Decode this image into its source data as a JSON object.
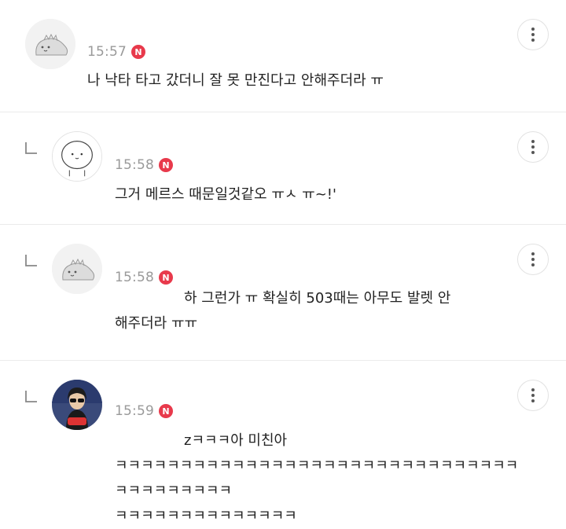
{
  "comments": [
    {
      "time": "15:57",
      "badge": "N",
      "text": "나 낙타 타고 갔더니 잘 못 만진다고 안해주더라 ㅠ",
      "avatar": "dinosaur-avatar-icon"
    },
    {
      "time": "15:58",
      "badge": "N",
      "text": "그거 메르스 때문일것같오 ㅠㅅ ㅠ~!'",
      "avatar": "round-character-avatar-icon"
    },
    {
      "time": "15:58",
      "badge": "N",
      "text_line1": "하 그런가 ㅠ 확실히 503때는 아무도 발렛 안",
      "text_line2": "해주더라 ㅠㅠ",
      "avatar": "dinosaur-avatar-icon"
    },
    {
      "time": "15:59",
      "badge": "N",
      "text_line1": "zㅋㅋㅋ아 미친아",
      "text_line2": "ㅋㅋㅋㅋㅋㅋㅋㅋㅋㅋㅋㅋㅋㅋㅋㅋㅋㅋㅋㅋㅋㅋㅋㅋㅋㅋㅋㅋㅋㅋㅋㅋㅋㅋㅋㅋㅋㅋㅋㅋ",
      "text_line3": "ㅋㅋㅋㅋㅋㅋㅋㅋㅋㅋㅋㅋㅋㅋ",
      "avatar": "photo-avatar"
    }
  ],
  "icons": {
    "more": "more-vertical-icon",
    "reply": "reply-arrow-icon"
  },
  "colors": {
    "badge": "#e8394b",
    "time": "#9a9a9a",
    "divider": "#ebebeb"
  }
}
